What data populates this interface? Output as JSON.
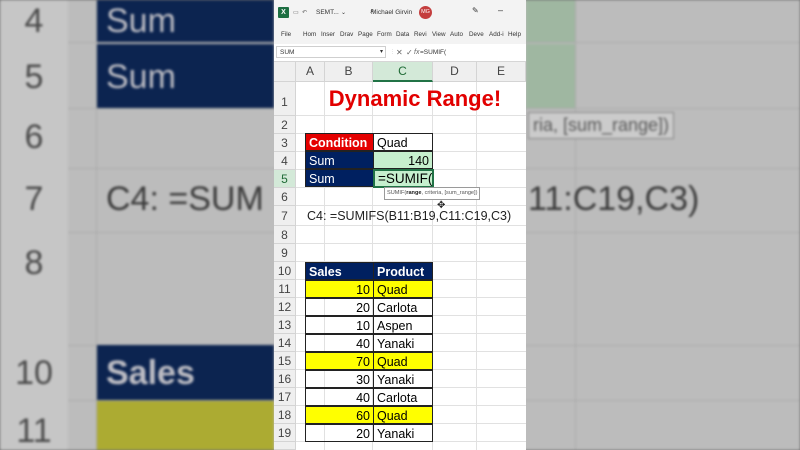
{
  "background": {
    "row_numbers": [
      "4",
      "5",
      "6",
      "7",
      "8",
      "10",
      "11"
    ],
    "texts": [
      "Sum",
      "Sum",
      "C4: =SUM",
      "11:C19,C3)",
      "ria, [sum_range])",
      "Sales"
    ]
  },
  "titlebar": {
    "app_icon": "X",
    "file_name": "SEMT...",
    "user_name": "Michael Girvin",
    "user_initials": "MG"
  },
  "ribbon": {
    "tabs": [
      "File",
      "Hom",
      "Inser",
      "Drav",
      "Page",
      "Form",
      "Data",
      "Revi",
      "View",
      "Auto",
      "Deve",
      "Add-i",
      "Help"
    ]
  },
  "formula_bar": {
    "name_box": "SUM",
    "cancel": "✕",
    "enter": "✓",
    "fx": "fx",
    "formula": "=SUMIF("
  },
  "columns": [
    "A",
    "B",
    "C",
    "D",
    "E"
  ],
  "rows": [
    "1",
    "2",
    "3",
    "4",
    "5",
    "6",
    "7",
    "8",
    "9",
    "10",
    "11",
    "12",
    "13",
    "14",
    "15",
    "16",
    "17",
    "18",
    "19"
  ],
  "sheet": {
    "title": "Dynamic Range!",
    "condition_label": "Condition",
    "condition_value": "Quad",
    "sum_label_1": "Sum",
    "sum_value": "140",
    "sum_label_2": "Sum",
    "editing_formula": "=SUMIF(",
    "tooltip_fn": "SUMIF(",
    "tooltip_arg1": "range",
    "tooltip_rest": ", criteria, [sum_range])",
    "formula_note": "C4: =SUMIFS(B11:B19,C11:C19,C3)",
    "table_headers": [
      "Sales",
      "Product"
    ],
    "table_rows": [
      {
        "sales": "10",
        "product": "Quad"
      },
      {
        "sales": "20",
        "product": "Carlota"
      },
      {
        "sales": "10",
        "product": "Aspen"
      },
      {
        "sales": "40",
        "product": "Yanaki"
      },
      {
        "sales": "70",
        "product": "Quad"
      },
      {
        "sales": "30",
        "product": "Yanaki"
      },
      {
        "sales": "40",
        "product": "Carlota"
      },
      {
        "sales": "60",
        "product": "Quad"
      },
      {
        "sales": "20",
        "product": "Yanaki"
      }
    ]
  },
  "colors": {
    "title_red": "#e20000",
    "header_navy": "#002060",
    "highlight_yellow": "#ffff00",
    "sum_green": "#c6efce",
    "excel_green": "#217346"
  }
}
